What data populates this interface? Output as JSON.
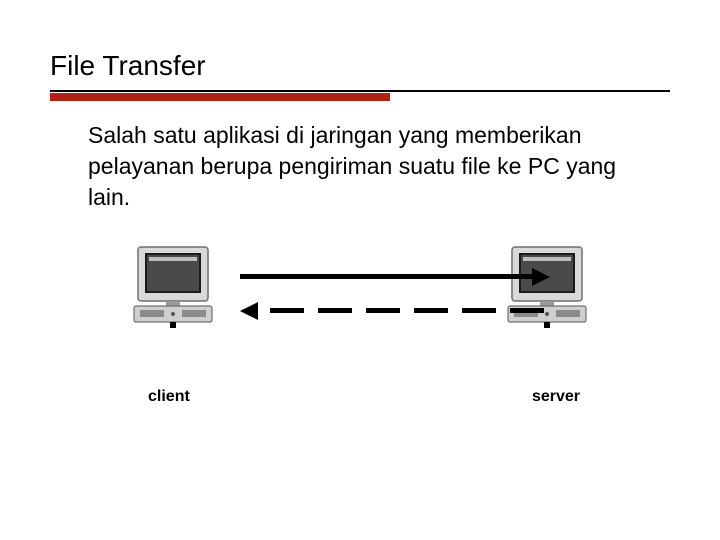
{
  "title": "File Transfer",
  "description": "Salah satu aplikasi di jaringan yang memberikan pelayanan berupa pengiriman suatu file ke PC yang lain.",
  "diagram": {
    "left_label": "client",
    "right_label": "server",
    "arrows": {
      "top": "solid-right",
      "bottom": "dashed-left"
    }
  }
}
